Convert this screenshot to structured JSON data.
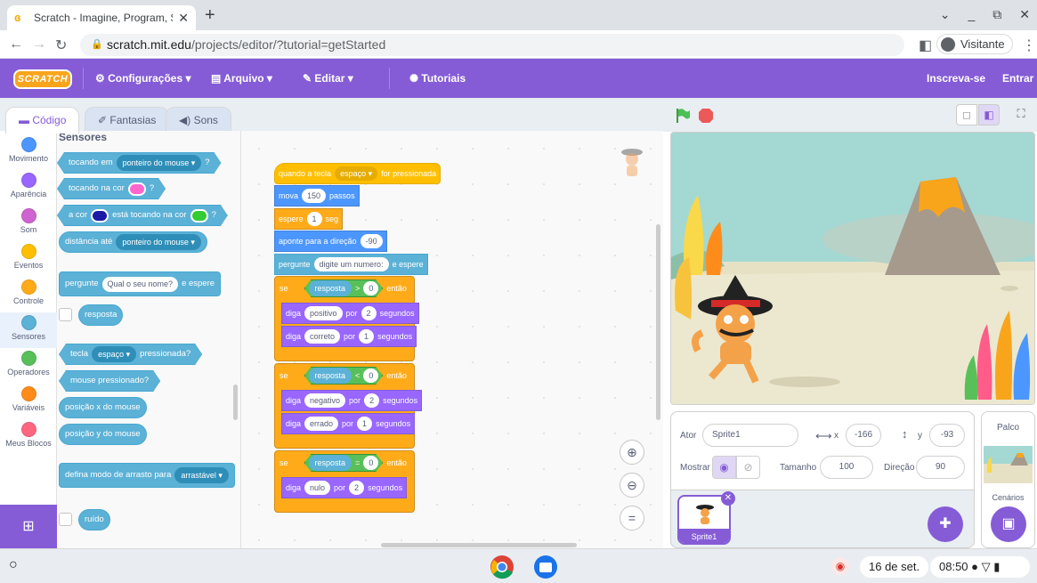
{
  "browser": {
    "tab_title": "Scratch - Imagine, Program, Sha",
    "url_domain": "scratch.mit.edu",
    "url_path": "/projects/editor/?tutorial=getStarted",
    "profile": "Visitante"
  },
  "menu": {
    "logo": "SCRATCH",
    "settings": "Configurações",
    "file": "Arquivo",
    "edit": "Editar",
    "tutorials": "Tutoriais",
    "join": "Inscreva-se",
    "signin": "Entrar"
  },
  "tabs": {
    "code": "Código",
    "costumes": "Fantasias",
    "sounds": "Sons"
  },
  "categories": [
    {
      "label": "Movimento",
      "color": "#4c97ff"
    },
    {
      "label": "Aparência",
      "color": "#9966ff"
    },
    {
      "label": "Som",
      "color": "#cf63cf"
    },
    {
      "label": "Eventos",
      "color": "#ffbf00"
    },
    {
      "label": "Controle",
      "color": "#ffab19"
    },
    {
      "label": "Sensores",
      "color": "#5cb1d6"
    },
    {
      "label": "Operadores",
      "color": "#59c059"
    },
    {
      "label": "Variáveis",
      "color": "#ff8c1a"
    },
    {
      "label": "Meus Blocos",
      "color": "#ff6680"
    }
  ],
  "palette": {
    "heading": "Sensores",
    "touching": "tocando em",
    "touching_dd": "ponteiro do mouse ▾",
    "q": "?",
    "touching_color": "tocando na cor",
    "color_is": "a cor",
    "is_touching": "está tocando na cor",
    "distance": "distância até",
    "distance_dd": "ponteiro do mouse ▾",
    "ask": "pergunte",
    "ask_val": "Qual o seu nome?",
    "and_wait": "e espere",
    "answer": "resposta",
    "key": "tecla",
    "key_dd": "espaço ▾",
    "pressed": "pressionada?",
    "mouse_down": "mouse pressionado?",
    "mouse_x": "posição x do mouse",
    "mouse_y": "posição y do mouse",
    "drag_mode": "defina modo de arrasto para",
    "drag_dd": "arrastável ▾",
    "loudness": "ruído"
  },
  "script": {
    "hat": "quando a tecla",
    "hat_key": "espaço ▾",
    "hat_end": "for pressionada",
    "move": "mova",
    "move_val": "150",
    "steps": "passos",
    "wait": "espere",
    "wait_val": "1",
    "sec": "seg",
    "point": "aponte para a direção",
    "point_val": "-90",
    "ask": "pergunte",
    "ask_val": "digite um numero:",
    "ask_end": "e espere",
    "if": "se",
    "then": "então",
    "answer": "resposta",
    "gt": ">",
    "lt": "<",
    "eq": "=",
    "zero": "0",
    "say": "diga",
    "for": "por",
    "seconds": "segundos",
    "positivo": "positivo",
    "correto": "correto",
    "negativo": "negativo",
    "errado": "errado",
    "nulo": "nulo",
    "two": "2",
    "one": "1"
  },
  "zoom": {
    "in": "+",
    "out": "−",
    "reset": "="
  },
  "sprite_info": {
    "sprite_label": "Ator",
    "sprite_name": "Sprite1",
    "x_label": "x",
    "x_val": "-166",
    "y_label": "y",
    "y_val": "-93",
    "show_label": "Mostrar",
    "size_label": "Tamanho",
    "size_val": "100",
    "dir_label": "Direção",
    "dir_val": "90",
    "thumb_name": "Sprite1"
  },
  "stage_pane": {
    "title": "Palco",
    "backdrops": "Cenários"
  },
  "shelf": {
    "date": "16 de set.",
    "time": "08:50"
  }
}
